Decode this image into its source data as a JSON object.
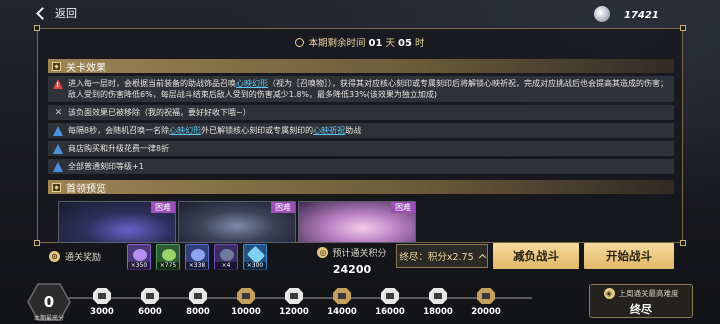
{
  "topbar": {
    "back_label": "返回",
    "currency_value": "17421"
  },
  "panel": {
    "timer_prefix": "本期剩余时间",
    "timer_days": "01",
    "timer_days_unit": "天",
    "timer_hours": "05",
    "timer_hours_unit": "时",
    "stage_effects_title": "关卡效果",
    "effects": [
      {
        "icon": "warning-icon",
        "parts": [
          "进入每一层时，会根据当前装备的助战饰品召唤",
          "心映幻形",
          "（视为［召唤物］），获得其对应核心刻印或专属刻印后将解锁心映祈祝，完成对应挑战后也会提高其造成的伤害；敌人受到的伤害降低6%，每层战斗结束后敌人受到的伤害减少1.8%，最多降低33%(该效果为独立加成)"
        ]
      },
      {
        "icon": "pin-icon",
        "text": "该负面效果已被移除（我的祝福，要好好收下哦~）"
      },
      {
        "icon": "info-icon",
        "parts": [
          "每隔8秒，会随机召唤一名除",
          "心映幻形",
          "外已解锁核心刻印或专属刻印的",
          "心映祈祝",
          "助战"
        ]
      },
      {
        "icon": "info-icon",
        "text": "商店购买和升级花费一律8折"
      },
      {
        "icon": "info-icon",
        "text": "全部普通刻印等级+1"
      }
    ],
    "boss_preview_title": "首领预览",
    "bosses": [
      {
        "tag": "困难"
      },
      {
        "tag": "困难"
      },
      {
        "tag": "困难"
      }
    ]
  },
  "rewards": {
    "label": "通关奖励",
    "items": [
      {
        "count": "×350",
        "color": "#8a5fd6"
      },
      {
        "count": "×775",
        "color": "#4aa05a"
      },
      {
        "count": "×338",
        "color": "#5b6fc9"
      },
      {
        "count": "×4",
        "color": "#6a4fb0"
      },
      {
        "count": "×300",
        "color": "#3f8fd8"
      }
    ]
  },
  "score": {
    "label": "预计通关积分",
    "value": "24200"
  },
  "difficulty_button": {
    "label": "终尽：积分x2.75"
  },
  "actions": {
    "reduce_label": "减负战斗",
    "start_label": "开始战斗"
  },
  "track": {
    "current_value": "0",
    "current_label": "本期最高分",
    "milestones": [
      "3000",
      "6000",
      "8000",
      "10000",
      "12000",
      "14000",
      "16000",
      "18000",
      "20000"
    ]
  },
  "best": {
    "label": "上周通关最高难度",
    "value": "终尽"
  },
  "colors": {
    "accent_gold": "#e1b96a",
    "link_blue": "#5fc8f0",
    "hard_tag": "#9c4fb8"
  }
}
